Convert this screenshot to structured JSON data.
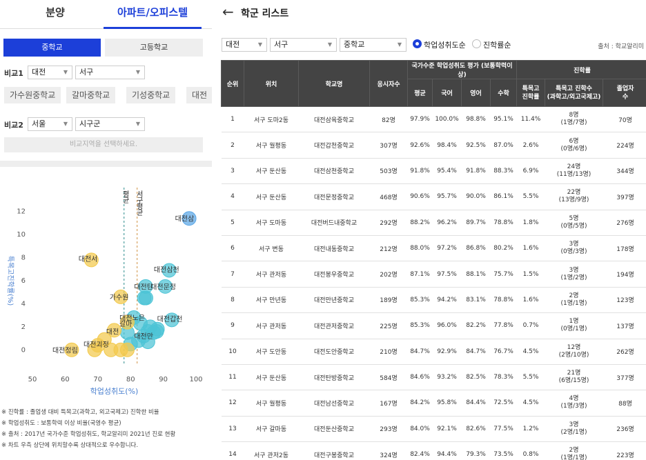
{
  "top_tabs": [
    "분양",
    "아파트/오피스텔"
  ],
  "school_level_tabs": [
    "중학교",
    "고등학교"
  ],
  "compare1": {
    "label": "비교1",
    "city": "대전",
    "district": "서구"
  },
  "compare1_chips": [
    "가수원중학교",
    "갈마중학교",
    "기성중학교",
    "대전"
  ],
  "compare2": {
    "label": "비교2",
    "city": "서울",
    "district": "시구군",
    "button": "비교지역을 선택하세요."
  },
  "chart_data": {
    "type": "scatter",
    "xlabel": "학업성취도(%)",
    "ylabel": "특목고진학률(%)",
    "xlim": [
      50,
      100
    ],
    "ylim": [
      -1,
      13
    ],
    "xticks": [
      50,
      60,
      70,
      80,
      90,
      100
    ],
    "yticks": [
      0,
      2,
      4,
      6,
      8,
      10,
      12
    ],
    "vlines": [
      {
        "x": 78,
        "label": "평균",
        "color": "#2a8a8a"
      },
      {
        "x": 82,
        "label": "서구평균",
        "color": "#d09040"
      }
    ],
    "points": [
      {
        "x": 97.9,
        "y": 11.4,
        "label": "대전삼",
        "color": "#5aa6e6"
      },
      {
        "x": 91.8,
        "y": 6.9,
        "label": "대전삼천",
        "color": "#4cc4d6"
      },
      {
        "x": 90.6,
        "y": 5.5,
        "label": "대전문정",
        "color": "#4cc4d6"
      },
      {
        "x": 88.2,
        "y": 1.8,
        "label": "대전버",
        "color": "#4cc4d6"
      },
      {
        "x": 92.6,
        "y": 2.6,
        "label": "대전갑천",
        "color": "#4cc4d6"
      },
      {
        "x": 85.3,
        "y": 1.6,
        "label": "대전만",
        "color": "#4cc4d6"
      },
      {
        "x": 85.3,
        "y": 0.7,
        "label": "",
        "color": "#4cc4d6"
      },
      {
        "x": 84.7,
        "y": 4.5,
        "label": "",
        "color": "#4cc4d6"
      },
      {
        "x": 84.6,
        "y": 5.5,
        "label": "대전탄",
        "color": "#4cc4d6"
      },
      {
        "x": 84.2,
        "y": 4.5,
        "label": "대전남",
        "color": "#4cc4d6"
      },
      {
        "x": 84.0,
        "y": 1.2,
        "label": "",
        "color": "#4cc4d6"
      },
      {
        "x": 82.4,
        "y": 0.8,
        "label": "",
        "color": "#4cc4d6"
      },
      {
        "x": 88.0,
        "y": 1.6,
        "label": "",
        "color": "#4cc4d6"
      },
      {
        "x": 87.1,
        "y": 1.5,
        "label": "",
        "color": "#4cc4d6"
      },
      {
        "x": 81.0,
        "y": 2.8,
        "label": "대전노은",
        "color": "#4cc4d6"
      },
      {
        "x": 79.0,
        "y": 1.5,
        "label": "",
        "color": "#4cc4d6"
      },
      {
        "x": 80.0,
        "y": 0.5,
        "label": "",
        "color": "#4cc4d6"
      },
      {
        "x": 83.0,
        "y": 2.3,
        "label": "",
        "color": "#4cc4d6"
      },
      {
        "x": 86.0,
        "y": 2.0,
        "label": "",
        "color": "#4cc4d6"
      },
      {
        "x": 68.0,
        "y": 7.8,
        "label": "대전서",
        "color": "#f2c94c"
      },
      {
        "x": 77.0,
        "y": 4.6,
        "label": "가수원",
        "color": "#f2c94c"
      },
      {
        "x": 79.0,
        "y": 2.4,
        "label": "갈마",
        "color": "#f2c94c"
      },
      {
        "x": 75.0,
        "y": 1.7,
        "label": "대전",
        "color": "#f2c94c"
      },
      {
        "x": 70.0,
        "y": 0.4,
        "label": "대전괴정",
        "color": "#f2c94c"
      },
      {
        "x": 62.0,
        "y": 0.0,
        "label": "대전정림",
        "color": "#f2c94c"
      },
      {
        "x": 69.0,
        "y": 0.0,
        "label": "",
        "color": "#f2c94c"
      },
      {
        "x": 74.0,
        "y": 0.0,
        "label": "",
        "color": "#f2c94c"
      },
      {
        "x": 77.0,
        "y": 0.0,
        "label": "",
        "color": "#f2c94c"
      },
      {
        "x": 79.0,
        "y": 0.0,
        "label": "",
        "color": "#f2c94c"
      },
      {
        "x": 72.0,
        "y": 0.9,
        "label": "",
        "color": "#f2c94c"
      }
    ]
  },
  "chart_labels": [
    {
      "text": "대전정림",
      "x": 60.0,
      "y": 0.0
    },
    {
      "text": "대전괴정",
      "x": 69.5,
      "y": 0.5
    },
    {
      "text": "대전",
      "x": 74.5,
      "y": 1.6
    },
    {
      "text": "갈마",
      "x": 78.5,
      "y": 2.3
    },
    {
      "text": "대전노은",
      "x": 80.5,
      "y": 2.8
    },
    {
      "text": "가수원",
      "x": 76.5,
      "y": 4.6
    },
    {
      "text": "대전서",
      "x": 67.0,
      "y": 7.9
    },
    {
      "text": "대전탄",
      "x": 84.0,
      "y": 5.5
    },
    {
      "text": "대전문정",
      "x": 90.0,
      "y": 5.5
    },
    {
      "text": "대전삼천",
      "x": 91.0,
      "y": 7.0
    },
    {
      "text": "대전갑천",
      "x": 92.0,
      "y": 2.7
    },
    {
      "text": "대전삼",
      "x": 96.5,
      "y": 11.4
    },
    {
      "text": "대전만",
      "x": 84.0,
      "y": 1.2
    }
  ],
  "notes": [
    "※ 진학률 : 졸업생 대비 특목고(과학고, 외고국제고) 진학한 비율",
    "※ 학업성취도 : 보통학력 이상 비율(국영수 평균)",
    "※ 출처 : 2017년 국가수준 학업성취도, 학교알리미 2021년 진로 현황",
    "※ 차트 우측 상단에 위치할수록 상대적으로 우수합니다."
  ],
  "header": {
    "title": "학군 리스트"
  },
  "filters": {
    "city": "대전",
    "district": "서구",
    "level": "중학교",
    "sort_options": [
      "학업성취도순",
      "진학률순"
    ],
    "source": "출처 : 학교알리미"
  },
  "table": {
    "group_headers": [
      "국가수준 학업성취도 평가 (보통학력이상)",
      "진학률"
    ],
    "headers": [
      "순위",
      "위치",
      "학교명",
      "응시자수",
      "평균",
      "국어",
      "영어",
      "수학",
      "특목고\n진학률",
      "특목고 진학수\n(과학고/외고국제고)",
      "졸업자\n수"
    ],
    "rows": [
      {
        "rank": "1",
        "loc": "서구 도마2동",
        "name": "대전삼육중학교",
        "takers": "82명",
        "avg": "97.9%",
        "kor": "100.0%",
        "eng": "98.8%",
        "math": "95.1%",
        "rate": "11.4%",
        "cnt": "8명",
        "sub": "(1명/7명)",
        "grad": "70명"
      },
      {
        "rank": "2",
        "loc": "서구 월평동",
        "name": "대전갑천중학교",
        "takers": "307명",
        "avg": "92.6%",
        "kor": "98.4%",
        "eng": "92.5%",
        "math": "87.0%",
        "rate": "2.6%",
        "cnt": "6명",
        "sub": "(0명/6명)",
        "grad": "224명"
      },
      {
        "rank": "3",
        "loc": "서구 둔산동",
        "name": "대전삼천중학교",
        "takers": "503명",
        "avg": "91.8%",
        "kor": "95.4%",
        "eng": "91.8%",
        "math": "88.3%",
        "rate": "6.9%",
        "cnt": "24명",
        "sub": "(11명/13명)",
        "grad": "344명"
      },
      {
        "rank": "4",
        "loc": "서구 둔산동",
        "name": "대전문정중학교",
        "takers": "468명",
        "avg": "90.6%",
        "kor": "95.7%",
        "eng": "90.0%",
        "math": "86.1%",
        "rate": "5.5%",
        "cnt": "22명",
        "sub": "(13명/9명)",
        "grad": "397명"
      },
      {
        "rank": "5",
        "loc": "서구 도마동",
        "name": "대전버드내중학교",
        "takers": "292명",
        "avg": "88.2%",
        "kor": "96.2%",
        "eng": "89.7%",
        "math": "78.8%",
        "rate": "1.8%",
        "cnt": "5명",
        "sub": "(0명/5명)",
        "grad": "276명"
      },
      {
        "rank": "6",
        "loc": "서구 변동",
        "name": "대전내동중학교",
        "takers": "212명",
        "avg": "88.0%",
        "kor": "97.2%",
        "eng": "86.8%",
        "math": "80.2%",
        "rate": "1.6%",
        "cnt": "3명",
        "sub": "(0명/3명)",
        "grad": "178명"
      },
      {
        "rank": "7",
        "loc": "서구 관저동",
        "name": "대전봉우중학교",
        "takers": "202명",
        "avg": "87.1%",
        "kor": "97.5%",
        "eng": "88.1%",
        "math": "75.7%",
        "rate": "1.5%",
        "cnt": "3명",
        "sub": "(1명/2명)",
        "grad": "194명"
      },
      {
        "rank": "8",
        "loc": "서구 만년동",
        "name": "대전만년중학교",
        "takers": "189명",
        "avg": "85.3%",
        "kor": "94.2%",
        "eng": "83.1%",
        "math": "78.8%",
        "rate": "1.6%",
        "cnt": "2명",
        "sub": "(1명/1명)",
        "grad": "123명"
      },
      {
        "rank": "9",
        "loc": "서구 관저동",
        "name": "대전관저중학교",
        "takers": "225명",
        "avg": "85.3%",
        "kor": "96.0%",
        "eng": "82.2%",
        "math": "77.8%",
        "rate": "0.7%",
        "cnt": "1명",
        "sub": "(0명/1명)",
        "grad": "137명"
      },
      {
        "rank": "10",
        "loc": "서구 도안동",
        "name": "대전도안중학교",
        "takers": "210명",
        "avg": "84.7%",
        "kor": "92.9%",
        "eng": "84.7%",
        "math": "76.7%",
        "rate": "4.5%",
        "cnt": "12명",
        "sub": "(2명/10명)",
        "grad": "262명"
      },
      {
        "rank": "11",
        "loc": "서구 둔산동",
        "name": "대전탄방중학교",
        "takers": "584명",
        "avg": "84.6%",
        "kor": "93.2%",
        "eng": "82.5%",
        "math": "78.3%",
        "rate": "5.5%",
        "cnt": "21명",
        "sub": "(6명/15명)",
        "grad": "377명"
      },
      {
        "rank": "12",
        "loc": "서구 월평동",
        "name": "대전남선중학교",
        "takers": "167명",
        "avg": "84.2%",
        "kor": "95.8%",
        "eng": "84.4%",
        "math": "72.5%",
        "rate": "4.5%",
        "cnt": "4명",
        "sub": "(1명/3명)",
        "grad": "88명"
      },
      {
        "rank": "13",
        "loc": "서구 갈마동",
        "name": "대전둔산중학교",
        "takers": "293명",
        "avg": "84.0%",
        "kor": "92.1%",
        "eng": "82.6%",
        "math": "77.5%",
        "rate": "1.2%",
        "cnt": "3명",
        "sub": "(2명/1명)",
        "grad": "236명"
      },
      {
        "rank": "14",
        "loc": "서구 관저2동",
        "name": "대전구봉중학교",
        "takers": "324명",
        "avg": "82.4%",
        "kor": "94.4%",
        "eng": "79.3%",
        "math": "73.5%",
        "rate": "0.8%",
        "cnt": "2명",
        "sub": "(1명/1명)",
        "grad": "223명"
      }
    ]
  },
  "colors": {
    "accent": "#1c3fd9",
    "table_header": "#444444",
    "school_point": "#4cc4d6",
    "compare_point": "#f2c94c"
  }
}
